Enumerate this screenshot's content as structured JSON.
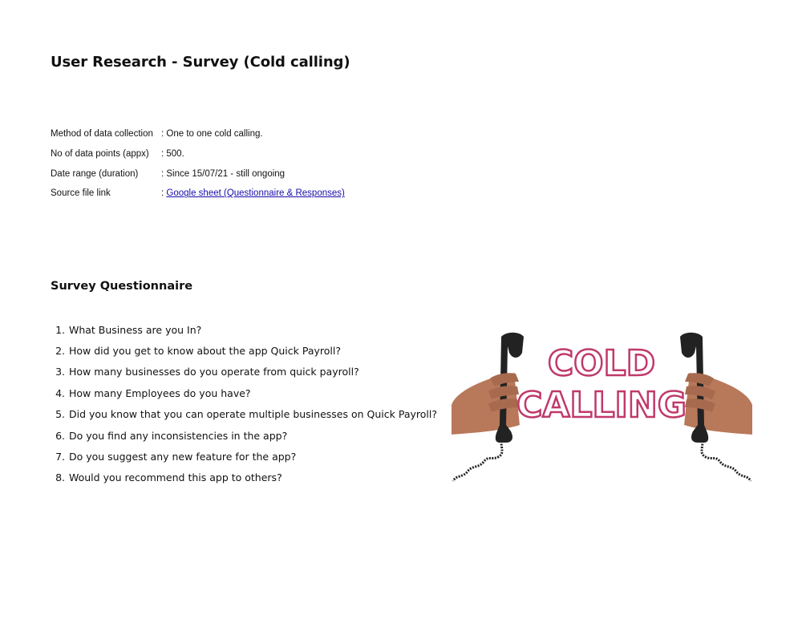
{
  "page": {
    "title": "User Research - Survey (Cold calling)"
  },
  "meta": [
    {
      "label": "Method of data collection",
      "value": ": One to one cold calling."
    },
    {
      "label": "No of data points (appx)",
      "value": ": 500."
    },
    {
      "label": "Date range (duration)",
      "value": ": Since 15/07/21 - still ongoing"
    },
    {
      "label": "Source file link",
      "prefix": ": ",
      "link_text": "Google sheet (Questionnaire & Responses)"
    }
  ],
  "survey": {
    "title": "Survey Questionnaire",
    "questions": [
      {
        "num": "1.",
        "text": "What Business are you In?"
      },
      {
        "num": "2.",
        "text": "How did you get to know about the app Quick Payroll?"
      },
      {
        "num": "3.",
        "text": "How many businesses do you operate from quick payroll?"
      },
      {
        "num": "4.",
        "text": "How many Employees do you have?"
      },
      {
        "num": "5.",
        "text": "Did you know that you can operate multiple businesses on Quick Payroll?"
      },
      {
        "num": "6.",
        "text": "Do you find any inconsistencies in the app?"
      },
      {
        "num": "7.",
        "text": "Do you suggest any new feature for the app?"
      },
      {
        "num": "8.",
        "text": "Would you recommend this app to others?"
      }
    ]
  },
  "illustration": {
    "line1": "COLD",
    "line2": "CALLING",
    "text_color": "#c0396b",
    "phone_color": "#222222",
    "skin_color": "#b8785a"
  }
}
